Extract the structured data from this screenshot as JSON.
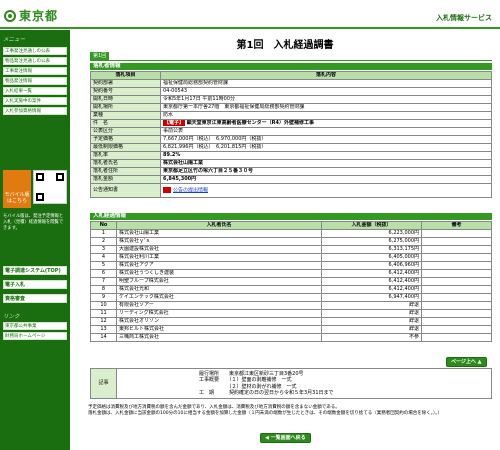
{
  "header": {
    "logo": "東京都",
    "service": "入札情報サービス"
  },
  "sidebar": {
    "menu_heading": "メニュー",
    "items": [
      "工事発注見通しの公表",
      "物品発注見通しの公表",
      "工事発注情報",
      "物品発注情報",
      "入札結果一覧",
      "入札実施中の案件",
      "入札参加資格情報"
    ],
    "mobile_label": "モバイル版\nはこちら",
    "mobile_text": "モバイル版は、発注予定情報と入札（見積）経過情報を閲覧できます。",
    "big_items": [
      "電子調達システム(TOP)",
      "電子入札",
      "資格審査"
    ],
    "links_heading": "リンク",
    "links": [
      "東京都公共事業",
      "財務局ホームページ"
    ]
  },
  "page": {
    "title": "第1回　入札経過調書",
    "tab": "第1回"
  },
  "bid_info": {
    "section": "落札者情報",
    "col_item": "落札項目",
    "col_content": "落札内容",
    "rows": [
      {
        "k": "契約部署",
        "v": "福祉保健局総務部契約管財課"
      },
      {
        "k": "契約番号",
        "v": "04-00543"
      },
      {
        "k": "開札日時",
        "v": "令和5年1月17日 午前11時00分"
      },
      {
        "k": "開札場所",
        "v": "東京都庁第一本庁舎27階　東京都福祉保健局総務部契約管財課"
      },
      {
        "k": "業種",
        "v": "防水"
      },
      {
        "k": "件　名",
        "tag": "【電子】",
        "v": "顕天堂東京江東高齢者医療センター（R4）外壁補修工事"
      },
      {
        "k": "公表区分",
        "v": "事前公表"
      },
      {
        "k": "予定価格",
        "v": "7,667,000円（税込）　6,970,000円（税抜）"
      },
      {
        "k": "最低制限価格",
        "v": "6,821,996円（税込）　6,201,815円（税抜）"
      },
      {
        "k": "落札率",
        "v": "89.2%"
      },
      {
        "k": "落札者氏名",
        "v": "株式会社山陽工業"
      },
      {
        "k": "落札者住所",
        "v": "東京都足立区竹の塚六丁目２５番３０号"
      },
      {
        "k": "落札金額",
        "v": "6,845,300円"
      },
      {
        "k": "公告通知書",
        "v": "公告の提出情報"
      }
    ]
  },
  "bidders": {
    "section": "入札経過情報",
    "col_no": "No",
    "col_name": "入札者氏名",
    "col_amount": "入札金額（税抜）",
    "col_remark": "備考",
    "rows": [
      {
        "no": "1",
        "name": "株式会社山陽工業",
        "amount": "6,223,000円"
      },
      {
        "no": "2",
        "name": "株式会社ｙ'ｓ",
        "amount": "6,275,000円"
      },
      {
        "no": "3",
        "name": "大園建設株式会社",
        "amount": "6,313,175円"
      },
      {
        "no": "4",
        "name": "株式会社利川工業",
        "amount": "6,405,000円"
      },
      {
        "no": "5",
        "name": "株式会社アクア",
        "amount": "6,406,960円"
      },
      {
        "no": "6",
        "name": "株式会社うつくしき建装",
        "amount": "6,412,400円"
      },
      {
        "no": "7",
        "name": "明聖ブループ株式会社",
        "amount": "6,412,400円"
      },
      {
        "no": "8",
        "name": "株式会社光和",
        "amount": "6,412,400円"
      },
      {
        "no": "9",
        "name": "ケイエンテック株式会社",
        "amount": "6,947,400円"
      },
      {
        "no": "10",
        "name": "有限会社ソアー",
        "amount": "辞退"
      },
      {
        "no": "11",
        "name": "リーディング株式会社",
        "amount": "辞退"
      },
      {
        "no": "12",
        "name": "株式会社オリゾン",
        "amount": "辞退"
      },
      {
        "no": "13",
        "name": "東邦ビルト株式会社",
        "amount": "辞退"
      },
      {
        "no": "14",
        "name": "三幟商工株式会社",
        "amount": "不参"
      }
    ],
    "page_top": "ページ上へ"
  },
  "remarks": {
    "label": "記事",
    "lines": [
      "履行場所　　東京都江東区新砂三丁目3番20号",
      "工事概要　　（１）壁面の剥離補修　一式",
      "　　　　　　（２）壁材の剥がれ補修　一式",
      "工　期　　　契約確定の日の翌日から令和５年3月31日まで"
    ]
  },
  "notes": [
    "予定価格は消費税及び地方消費税の額を含んだ金額であり、入札金額は、消費税及び地方消費税の額を含まない金額である。",
    "落札金額は、入札金額に当該金額の100分の10に相当する金額を加算した金額（１円未満の端数が生じたときは、その端数金額を切り捨てる（業務者団契約の場合を除く。）。）"
  ],
  "back_button": "一覧画面へ戻る"
}
